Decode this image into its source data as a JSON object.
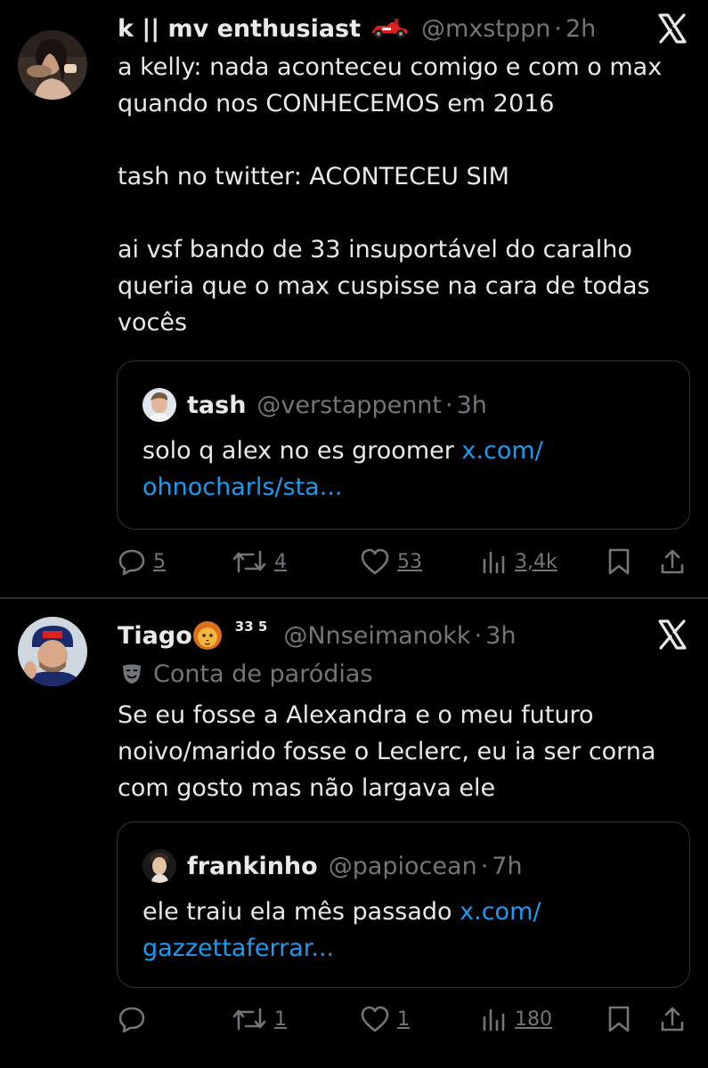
{
  "tweets": [
    {
      "author_name": "k || mv enthusiast",
      "author_emoji": "race-car-emoji",
      "handle": "@mxstppn",
      "sep": "·",
      "time": "2h",
      "body_lines": [
        "a kelly: nada aconteceu comigo e com o max",
        "quando nos CONHECEMOS em 2016",
        "tash no twitter: ACONTECEU SIM",
        "ai vsf bando de 33 insuportável do caralho",
        "queria que o max cuspisse na cara de todas",
        "vocês"
      ],
      "quote": {
        "author_name": "tash",
        "handle": "@verstappennt",
        "sep": "·",
        "time": "3h",
        "text": "solo q alex no es groomer ",
        "link": "x.com/",
        "link2": "ohnocharls/sta..."
      },
      "stats": {
        "replies": "5",
        "retweets": "4",
        "likes": "53",
        "views": "3,4k"
      }
    },
    {
      "author_name": "Tiago",
      "author_emoji": "lion-emoji",
      "superscript": "33 5",
      "handle": "@Nnseimanokk",
      "sep": "·",
      "time": "3h",
      "parody_label": "Conta de paródias",
      "body_lines": [
        "Se eu fosse a Alexandra e o meu futuro",
        "noivo/marido fosse o Leclerc, eu ia ser corna",
        "com gosto mas não largava ele"
      ],
      "quote": {
        "author_name": "frankinho",
        "handle": "@papiocean",
        "sep": "·",
        "time": "7h",
        "text": "ele traiu ela mês passado ",
        "link": "x.com/",
        "link2": "gazzettaferrar..."
      },
      "stats": {
        "replies": "",
        "retweets": "1",
        "likes": "1",
        "views": "180"
      }
    }
  ],
  "colors": {
    "background": "#000000",
    "text": "#e7e9ea",
    "muted": "#71767b",
    "link": "#1d9bf0",
    "border": "#2f3336"
  }
}
